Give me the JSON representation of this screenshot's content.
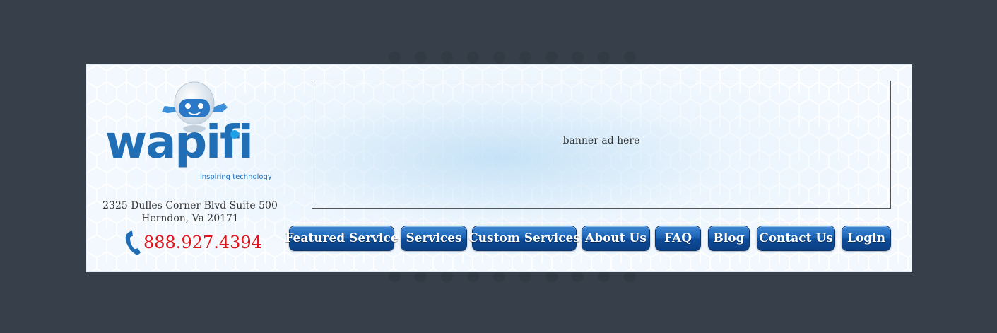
{
  "brand": {
    "logo_text": "wapifi",
    "tagline": "inspiring technology",
    "address_line1": "2325 Dulles Corner Blvd Suite 500",
    "address_line2": "Herndon, Va 20171",
    "phone": "888.927.4394"
  },
  "banner": {
    "text": "banner ad here"
  },
  "nav": {
    "items": [
      {
        "label": "Featured Service"
      },
      {
        "label": "Services"
      },
      {
        "label": "Custom Services"
      },
      {
        "label": "About Us"
      },
      {
        "label": "FAQ"
      },
      {
        "label": "Blog"
      },
      {
        "label": "Contact Us"
      },
      {
        "label": "Login"
      }
    ]
  },
  "colors": {
    "page_background": "#363f4a",
    "brand_blue": "#1f6eb6",
    "phone_red": "#e0141a",
    "button_blue": "#1e64b4"
  },
  "icons": {
    "robot": "robot-mascot-icon",
    "phone": "phone-handset-icon"
  }
}
